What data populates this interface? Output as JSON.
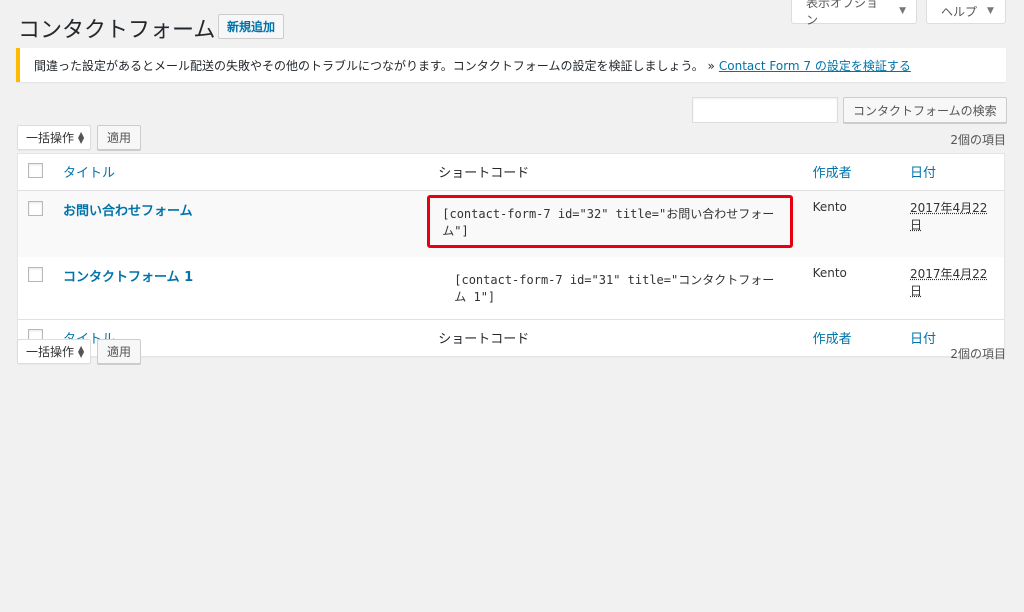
{
  "screen_options": {
    "display_label": "表示オプション",
    "help_label": "ヘルプ"
  },
  "header": {
    "title": "コンタクトフォーム",
    "add_new_label": "新規追加"
  },
  "notice": {
    "text": "間違った設定があるとメール配送の失敗やその他のトラブルにつながります。コンタクトフォームの設定を検証しましょう。 »",
    "link_text": "Contact Form 7 の設定を検証する"
  },
  "search": {
    "input_value": "",
    "button_label": "コンタクトフォームの検索"
  },
  "bulk": {
    "selected": "一括操作",
    "apply_label": "適用",
    "count_text": "2個の項目"
  },
  "table": {
    "columns": {
      "title": "タイトル",
      "shortcode": "ショートコード",
      "author": "作成者",
      "date": "日付"
    },
    "rows": [
      {
        "title": "お問い合わせフォーム",
        "shortcode": "[contact-form-7 id=\"32\" title=\"お問い合わせフォーム\"]",
        "author": "Kento",
        "date": "2017年4月22日"
      },
      {
        "title": "コンタクトフォーム 1",
        "shortcode": "[contact-form-7 id=\"31\" title=\"コンタクトフォーム 1\"]",
        "author": "Kento",
        "date": "2017年4月22日"
      }
    ]
  },
  "colors": {
    "link": "#0073aa",
    "notice_border": "#ffb900",
    "highlight_border": "#e60012"
  }
}
